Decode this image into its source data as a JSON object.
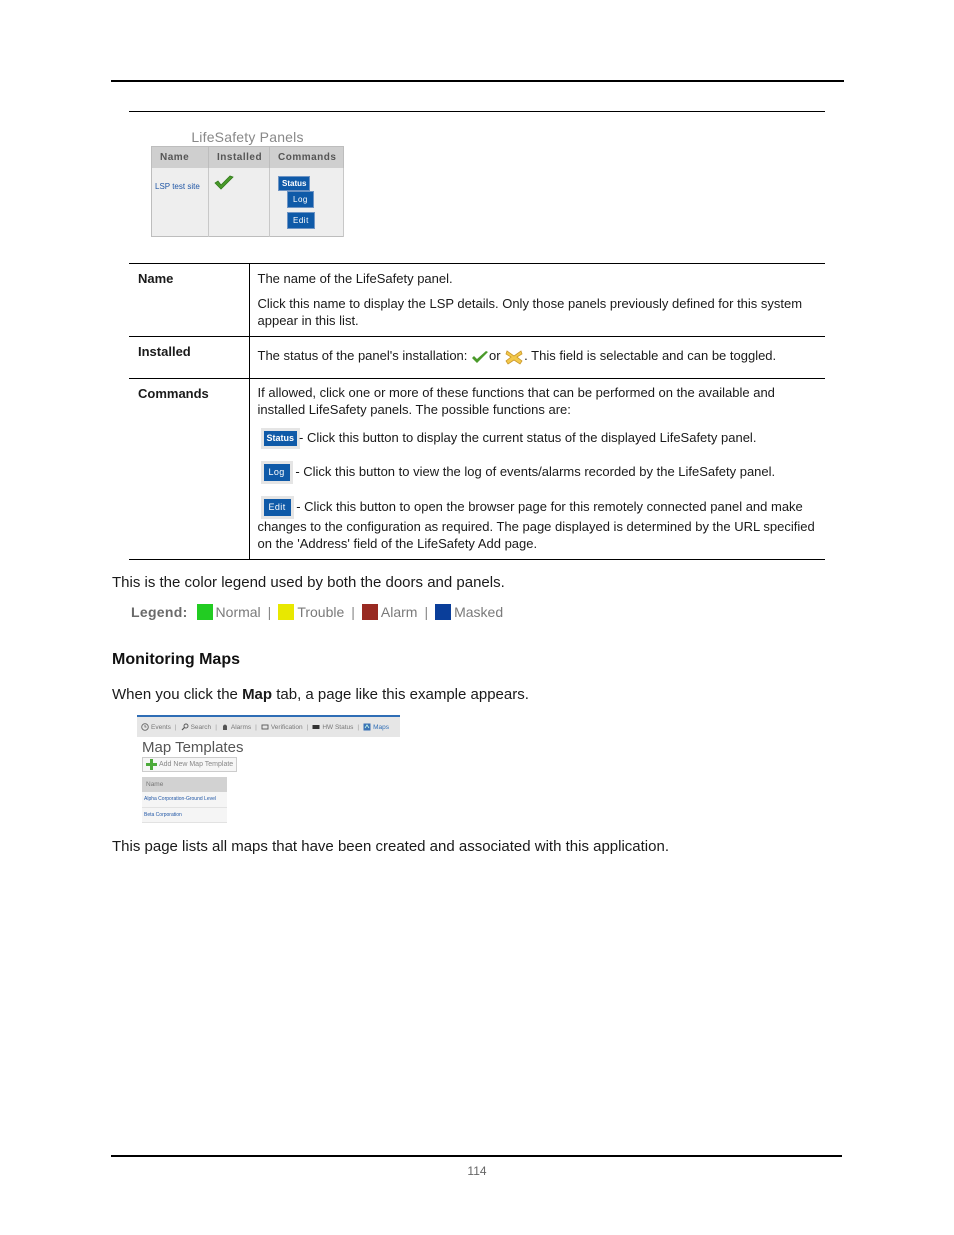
{
  "page": {
    "number": "114"
  },
  "lsp_screenshot": {
    "title": "LifeSafety Panels",
    "columns": [
      "Name",
      "Installed",
      "Commands"
    ],
    "row": {
      "name": "LSP test site",
      "installed_icon": "check-icon",
      "commands": [
        "Status",
        "Log",
        "Edit"
      ]
    }
  },
  "definitions": [
    {
      "term": "Name",
      "paragraphs": [
        "The name of the LifeSafety panel.",
        "Click this name to display the LSP details. Only those panels previously defined for this system appear in this list."
      ]
    },
    {
      "term": "Installed",
      "text_before": "The status of the panel's installation: ",
      "text_or": "or ",
      "text_after": ". This field is selectable and can be toggled.",
      "icons": [
        "check-icon",
        "x-icon"
      ]
    },
    {
      "term": "Commands",
      "intro": "If allowed, click one or more of these functions that can be performed on the available and installed LifeSafety panels. The possible functions are:",
      "commands": [
        {
          "button": "Status",
          "description": "- Click this button to display the current status of the displayed LifeSafety panel."
        },
        {
          "button": "Log",
          "description": " - Click this button to view the log of events/alarms recorded by the LifeSafety panel."
        },
        {
          "button": "Edit",
          "description": " - Click this button to open the browser page for this remotely connected panel and make changes to the configuration as required. The page displayed is determined by the URL specified on the 'Address' field of the LifeSafety Add page."
        }
      ]
    }
  ],
  "legend_intro": "This is the color legend used by both the doors and panels.",
  "legend": {
    "label": "Legend:",
    "items": [
      {
        "label": "Normal",
        "color": "#22cc22"
      },
      {
        "label": "Trouble",
        "color": "#e8e800"
      },
      {
        "label": "Alarm",
        "color": "#992a22"
      },
      {
        "label": "Masked",
        "color": "#0a3e9a"
      }
    ],
    "separator": "|"
  },
  "section": {
    "heading": "Monitoring Maps",
    "intro_before": "When you click the ",
    "intro_bold": "Map",
    "intro_after": " tab, a page like this example appears.",
    "closing": "This page lists all maps that have been created and associated with this application."
  },
  "map_screenshot": {
    "nav": [
      {
        "label": "Events",
        "icon": "clock-icon"
      },
      {
        "label": "Search",
        "icon": "search-icon"
      },
      {
        "label": "Alarms",
        "icon": "alarm-icon"
      },
      {
        "label": "Verification",
        "icon": "verification-icon"
      },
      {
        "label": "HW Status",
        "icon": "hw-status-icon"
      },
      {
        "label": "Maps",
        "icon": "map-icon"
      }
    ],
    "title": "Map Templates",
    "add_button": "Add New Map Template",
    "column": "Name",
    "rows": [
      "Alpha Corporation-Ground Level",
      "Beta Corporation"
    ]
  }
}
